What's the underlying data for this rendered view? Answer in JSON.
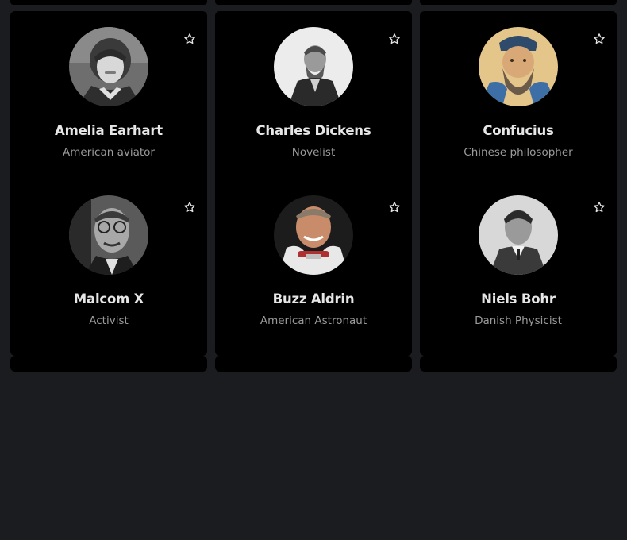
{
  "people": [
    {
      "name": "Amelia Earhart",
      "role": "American aviator",
      "icon": "star-outline-icon"
    },
    {
      "name": "Charles Dickens",
      "role": "Novelist",
      "icon": "star-outline-icon"
    },
    {
      "name": "Confucius",
      "role": "Chinese philosopher",
      "icon": "star-outline-icon"
    },
    {
      "name": "Malcom X",
      "role": "Activist",
      "icon": "star-outline-icon"
    },
    {
      "name": "Buzz Aldrin",
      "role": "American Astronaut",
      "icon": "star-outline-icon"
    },
    {
      "name": "Niels Bohr",
      "role": "Danish Physicist",
      "icon": "star-outline-icon"
    }
  ],
  "colors": {
    "page_background": "#1b1c1f",
    "card_background": "#000000",
    "name_text": "#e6e6e6",
    "role_text": "#9a9a9a"
  }
}
